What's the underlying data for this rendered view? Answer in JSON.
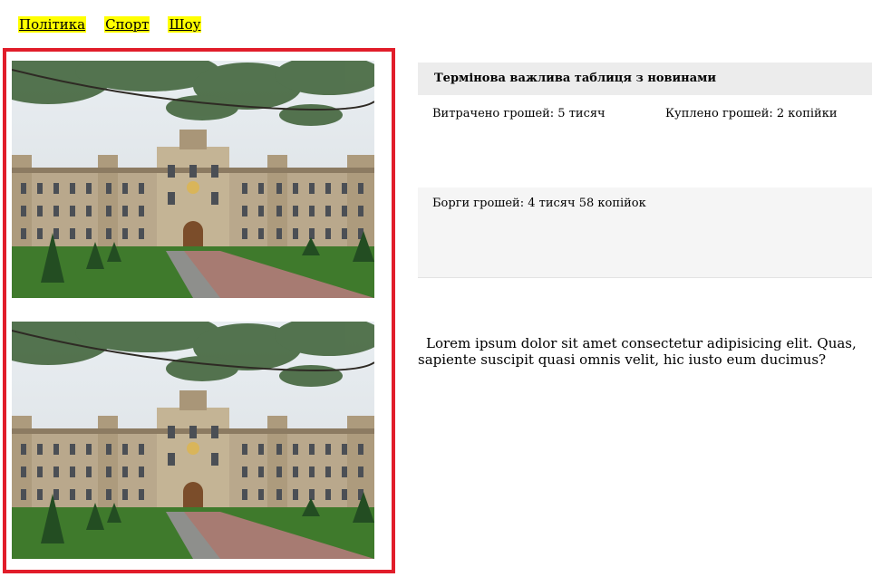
{
  "nav": {
    "items": [
      {
        "label": "Політика"
      },
      {
        "label": "Спорт"
      },
      {
        "label": "Шоу"
      }
    ]
  },
  "table": {
    "title": "Термінова важлива таблиця з новинами",
    "spent": "Витрачено грошей: 5 тисяч",
    "bought": "Куплено грошей: 2 копійки",
    "debts": "Борги грошей: 4 тисяч 58 копійок"
  },
  "content": {
    "paragraph": "Lorem ipsum dolor sit amet consectetur adipisicing elit. Quas, sapiente suscipit quasi omnis velit, hic iusto eum ducimus?"
  },
  "colors": {
    "frame_border": "#e11d2a",
    "nav_highlight": "#ffff00"
  }
}
